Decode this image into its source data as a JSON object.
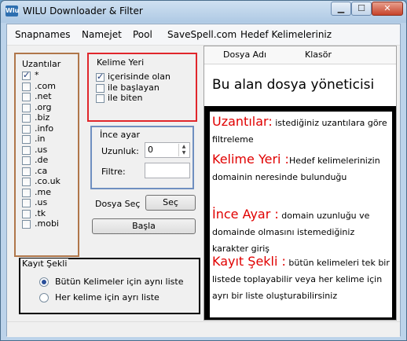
{
  "window": {
    "title": "WILU Downloader & Filter",
    "icon_text": "Wlu"
  },
  "menu": [
    "Snapnames",
    "Namejet",
    "Pool",
    "SaveSpell.com",
    "Hedef Kelimeleriniz"
  ],
  "extensions": {
    "title": "Uzantılar",
    "items": [
      {
        "label": "*",
        "checked": true
      },
      {
        "label": ".com",
        "checked": false
      },
      {
        "label": ".net",
        "checked": false
      },
      {
        "label": ".org",
        "checked": false
      },
      {
        "label": ".biz",
        "checked": false
      },
      {
        "label": ".info",
        "checked": false
      },
      {
        "label": ".in",
        "checked": false
      },
      {
        "label": ".us",
        "checked": false
      },
      {
        "label": ".de",
        "checked": false
      },
      {
        "label": ".ca",
        "checked": false
      },
      {
        "label": ".co.uk",
        "checked": false
      },
      {
        "label": ".me",
        "checked": false
      },
      {
        "label": ".us",
        "checked": false
      },
      {
        "label": ".tk",
        "checked": false
      },
      {
        "label": ".mobi",
        "checked": false
      }
    ]
  },
  "word_position": {
    "title": "Kelime Yeri",
    "items": [
      {
        "label": "içerisinde olan",
        "checked": true
      },
      {
        "label": "ile başlayan",
        "checked": false
      },
      {
        "label": "ile biten",
        "checked": false
      }
    ]
  },
  "fine_tune": {
    "title": "İnce ayar",
    "length_label": "Uzunluk:",
    "length_value": "0",
    "filter_label": "Filtre:",
    "filter_value": ""
  },
  "file_select": {
    "label": "Dosya Seç",
    "button": "Seç"
  },
  "start_button": "Başla",
  "save_mode": {
    "title": "Kayıt Şekli",
    "options": [
      {
        "label": "Bütün Kelimeler için aynı liste",
        "checked": true
      },
      {
        "label": "Her kelime için ayrı liste",
        "checked": false
      }
    ]
  },
  "file_grid": {
    "columns": [
      "Dosya Adı",
      "Klasör"
    ],
    "caption": "Bu alan dosya yöneticisi"
  },
  "notes": [
    {
      "title": "Uzantılar:",
      "text": " istediğiniz uzantılara göre filtreleme"
    },
    {
      "title": "Kelime Yeri :",
      "text": "Hedef kelimelerinizin domainin neresinde bulunduğu"
    },
    {
      "title": "İnce Ayar :",
      "text": " domain uzunluğu ve domainde olmasını istemediğiniz karakter giriş"
    },
    {
      "title": "Kayıt Şekli :",
      "text": " bütün kelimeleri tek bir listede toplayabilir veya her kelime için ayrı bir liste oluşturabilirsiniz"
    }
  ],
  "colors": {
    "extensions_box": "#b0764a",
    "word_box": "#e0262b",
    "fine_box": "#6f8fc0",
    "save_box": "#000000",
    "note_title": "#e00000"
  }
}
